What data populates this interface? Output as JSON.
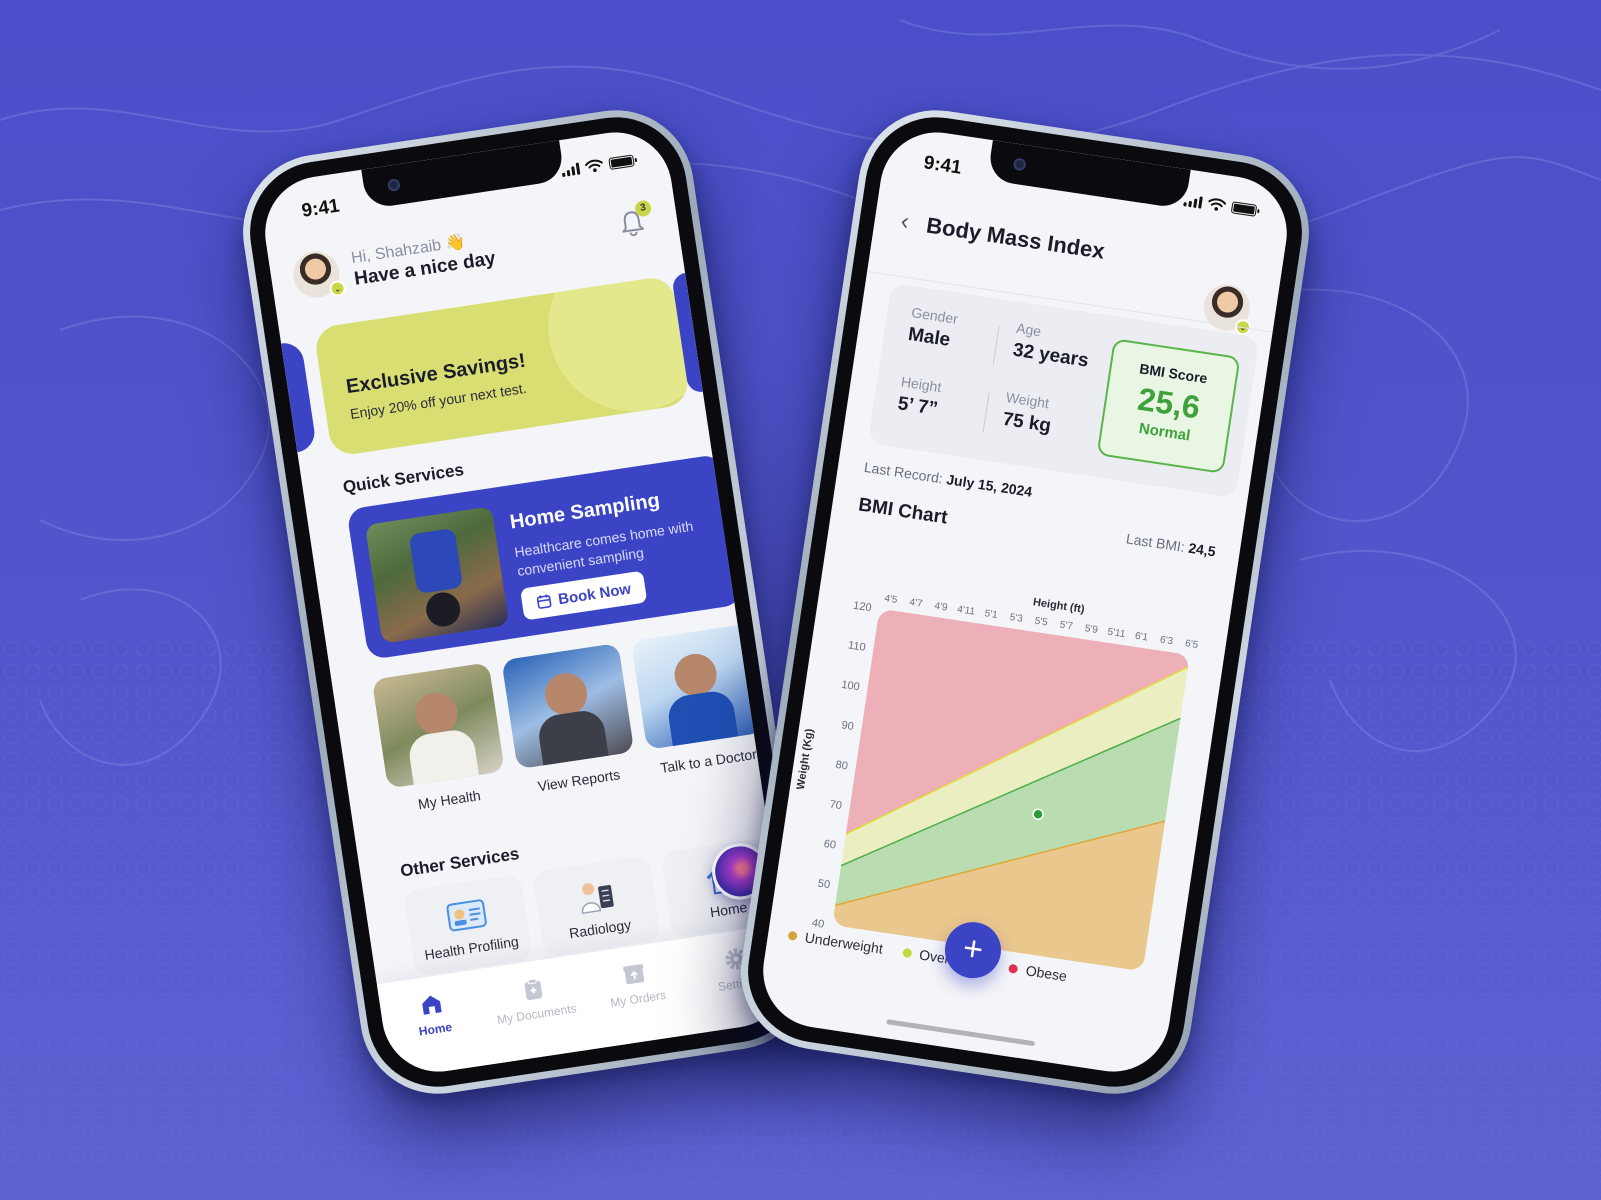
{
  "phone_home": {
    "status_time": "9:41",
    "greeting": "Hi, Shahzaib 👋",
    "subtitle": "Have a nice day",
    "notifications_count": "3",
    "promo": {
      "title": "Exclusive Savings!",
      "subtitle": "Enjoy 20% off your next test.",
      "color": "#d9de72"
    },
    "quick_services_title": "Quick Services",
    "home_sampling": {
      "title": "Home Sampling",
      "subtitle": "Healthcare comes home with convenient sampling",
      "button": "Book Now",
      "color": "#3b44c4"
    },
    "tiles": [
      {
        "label": "My Health"
      },
      {
        "label": "View Reports"
      },
      {
        "label": "Talk to a Doctor"
      }
    ],
    "other_services_title": "Other Services",
    "other_services": [
      {
        "label": "Health Profiling",
        "icon": "id-card-icon"
      },
      {
        "label": "Radiology",
        "icon": "doctor-xray-icon"
      },
      {
        "label": "Home",
        "icon": "house-doctor-icon"
      }
    ],
    "tabs": [
      {
        "label": "Home",
        "icon": "home-icon",
        "active": true
      },
      {
        "label": "My Documents",
        "icon": "clipboard-icon",
        "active": false
      },
      {
        "label": "My Orders",
        "icon": "box-icon",
        "active": false
      },
      {
        "label": "Settings",
        "icon": "gear-icon",
        "active": false
      }
    ]
  },
  "phone_bmi": {
    "status_time": "9:41",
    "title": "Body Mass Index",
    "stats": {
      "gender_label": "Gender",
      "gender": "Male",
      "age_label": "Age",
      "age": "32 years",
      "height_label": "Height",
      "height": "5’ 7”",
      "weight_label": "Weight",
      "weight": "75 kg"
    },
    "bmi_score": {
      "label": "BMI Score",
      "value": "25,6",
      "status": "Normal"
    },
    "last_record_label": "Last Record:",
    "last_record": "July 15, 2024",
    "last_bmi_label": "Last BMI:",
    "last_bmi": "24,5",
    "chart_title": "BMI Chart",
    "legend": [
      {
        "label": "Underweight",
        "color": "#d9a23a"
      },
      {
        "label": "Overweight",
        "color": "#c5d83a"
      },
      {
        "label": "Obese",
        "color": "#e0324d"
      }
    ]
  },
  "chart_data": {
    "type": "area",
    "title": "BMI Chart",
    "xlabel": "Height (ft)",
    "ylabel": "Weight (Kg)",
    "x_ticks": [
      "4'5",
      "4'7",
      "4'9",
      "4'11",
      "5'1",
      "5'3",
      "5'5",
      "5'7",
      "5'9",
      "5'11",
      "6'1",
      "6'3",
      "6'5"
    ],
    "y_ticks": [
      40,
      50,
      60,
      70,
      80,
      90,
      100,
      110,
      120
    ],
    "ylim": [
      40,
      120
    ],
    "bands": [
      {
        "name": "Underweight",
        "color": "#eac78c"
      },
      {
        "name": "Normal",
        "color": "#b9ddb0"
      },
      {
        "name": "Overweight",
        "color": "#eaeec0"
      },
      {
        "name": "Obese",
        "color": "#eeb0b8"
      }
    ],
    "boundaries": [
      {
        "name": "Underweight/Normal",
        "y_start": 45,
        "y_end": 78
      },
      {
        "name": "Normal/Overweight",
        "y_start": 55,
        "y_end": 104
      },
      {
        "name": "Overweight/Obese",
        "y_start": 63,
        "y_end": 117
      }
    ],
    "point": {
      "x": "5'7",
      "y": 75
    }
  }
}
